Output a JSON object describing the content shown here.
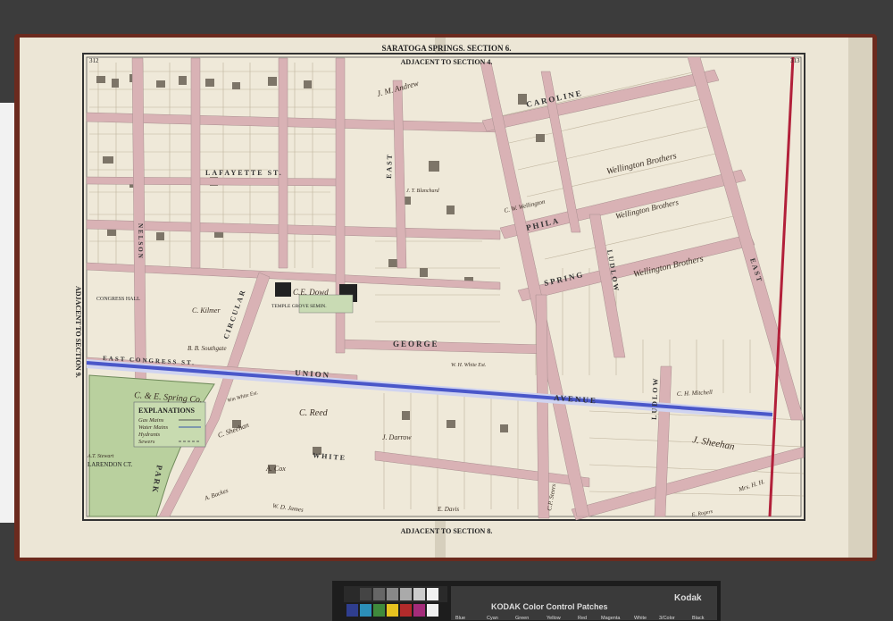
{
  "map": {
    "title": "SARATOGA SPRINGS. SECTION 6.",
    "adjacent_top": "ADJACENT TO SECTION 4.",
    "adjacent_bottom": "ADJACENT TO SECTION 8.",
    "adjacent_left": "ADJACENT TO SECTION 9.",
    "page_left": "312",
    "page_right": "313"
  },
  "streets": {
    "caroline": "CAROLINE",
    "lafayette": "LAFAYETTE ST.",
    "phila": "PHILA",
    "spring": "SPRING",
    "george": "GEORGE",
    "union": "UNION",
    "avenue": "AVENUE",
    "east_congress": "EAST CONGRESS ST.",
    "white": "WHITE",
    "east": "EAST",
    "ludlow": "LUDLOW",
    "circular": "CIRCULAR",
    "park": "PARK",
    "larendon": "LARENDON CT.",
    "st": "ST.",
    "nelson": "NELSON"
  },
  "owners": {
    "c_e_spring": "C. & E. Spring Co.",
    "c_kilmer": "C. Kilmer",
    "c_reed": "C. Reed",
    "c_e_dowd": "C.E. Dowd",
    "temple_grove": "TEMPLE GROVE SEMIN.",
    "wellington_brothers_1": "Wellington Brothers",
    "wellington_brothers_2": "Wellington Brothers",
    "wellington_brothers_3": "Wellington Brothers",
    "c_sheehan": "C. Sheehan",
    "j_sheehan": "J. Sheehan",
    "a_cox": "A. Cox",
    "j_darrow": "J. Darrow",
    "e_davis": "E. Davis",
    "j_m_andrew": "J. M. Andrew",
    "c_h_mitchell": "C. H. Mitchell",
    "c_w_wellington": "C. W. Wellington",
    "b_b_southgate": "B. B. Southgate",
    "congress_hall": "CONGRESS HALL",
    "a_t_stewart": "A.T. Stewart",
    "w_h_wheeler": "W. H. White Est.",
    "e_rogers": "E. Rogers",
    "c_p_steers": "C.P. Steers",
    "w_d_james": "W. D. James",
    "a_backes": "A. Backes",
    "mrs_h_h": "Mrs. H. H.",
    "j_t_blanchard": "J. T. Blanchard",
    "wm_white": "Wm White Est."
  },
  "explanations": {
    "title": "EXPLANATIONS",
    "items": [
      "Gas Mains",
      "Water Mains",
      "Hydrants",
      "Sewers"
    ]
  },
  "color_bar": {
    "title": "KODAK Color Control Patches",
    "brand": "Kodak",
    "labels": [
      "Blue",
      "Cyan",
      "Green",
      "Yellow",
      "Red",
      "Magenta",
      "White",
      "3/Color",
      "Black"
    ],
    "colors": {
      "blue": "#2f3e8f",
      "cyan": "#2c8fb8",
      "green": "#3f8a3c",
      "yellow": "#e6c21f",
      "red": "#b22b2b",
      "magenta": "#a42c7a",
      "white": "#f0f0f0",
      "black": "#111111"
    }
  },
  "colors": {
    "paper": "#ece6d6",
    "street_pink": "#d9b2b5",
    "park_green": "#b9d09e",
    "union_blue": "#4a57c9",
    "red_line": "#b2203a"
  }
}
